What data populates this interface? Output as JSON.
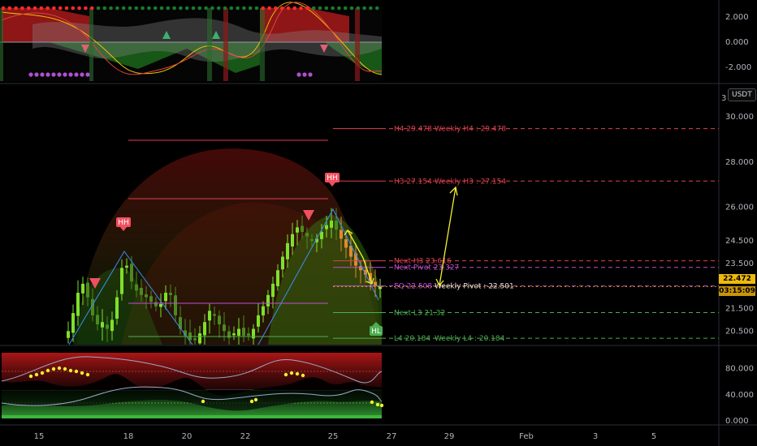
{
  "currency": "USDT",
  "colors": {
    "bull": "#4caf50",
    "bull_bright": "#76e02a",
    "bear": "#e53935",
    "pivot_magenta": "#c050d0",
    "resistance": "#e04050",
    "support": "#4caf50",
    "fib": "#3a8ff0",
    "arrow": "#f0f030",
    "price_tag": "#f0b90b"
  },
  "chart_data": [
    {
      "type": "area",
      "panel": "oscillator-top",
      "y_ticks": [
        "2.000",
        "0.000",
        "-2.000"
      ],
      "ylim": [
        -3,
        3
      ]
    },
    {
      "type": "bar",
      "panel": "price",
      "y_ticks": [
        "30.000",
        "28.000",
        "26.000",
        "24.500",
        "23.500",
        "21.500",
        "20.500"
      ],
      "ylim": [
        19.9,
        31.3
      ],
      "last_price": "22.472",
      "countdown": "03:15:09",
      "levels": [
        {
          "label": "H4 29.478",
          "weekly": "Weekly H4 : 29.478",
          "value": 29.478,
          "color": "#e04050"
        },
        {
          "label": "H3 27.154",
          "weekly": "Weekly H3 : 27.154",
          "value": 27.154,
          "color": "#e04050"
        },
        {
          "label": "Next H3 23.616",
          "weekly": "",
          "value": 23.616,
          "color": "#e04050"
        },
        {
          "label": "Next Pivot 23.327",
          "weekly": "",
          "value": 23.327,
          "color": "#c050d0"
        },
        {
          "label": "EQ 22.508",
          "weekly": "Weekly Pivot : 22.501",
          "value": 22.501,
          "color": "#c050d0"
        },
        {
          "label": "Next L3 21.32",
          "weekly": "",
          "value": 21.32,
          "color": "#4caf50"
        },
        {
          "label": "L4 20.184",
          "weekly": "Weekly L4 : 20.184",
          "value": 20.184,
          "color": "#4caf50"
        }
      ],
      "signal_labels": [
        "HH",
        "HH",
        "HL"
      ]
    },
    {
      "type": "line",
      "panel": "rsi-bottom",
      "y_ticks": [
        "80.000",
        "40.000",
        "0.000"
      ],
      "ylim": [
        0,
        100
      ]
    }
  ],
  "x_axis": [
    "15",
    "18",
    "20",
    "22",
    "25",
    "27",
    "29",
    "Feb",
    "3",
    "5"
  ]
}
